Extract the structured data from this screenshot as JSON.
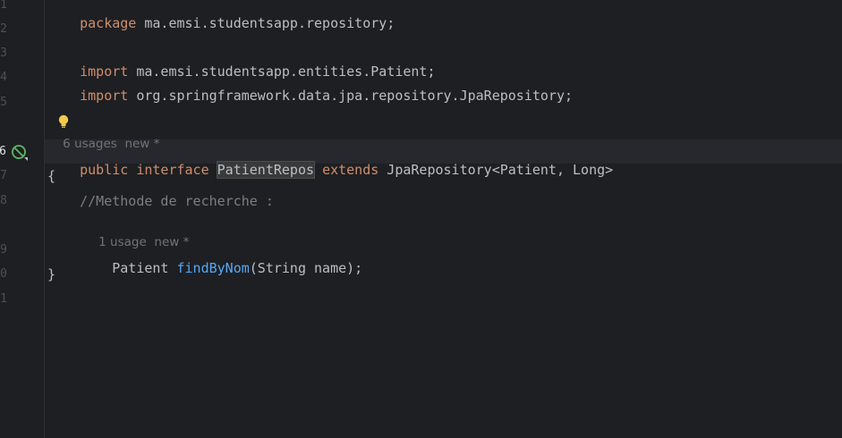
{
  "gutter": {
    "line_numbers": [
      "1",
      "2",
      "3",
      "4",
      "5",
      "6",
      "7",
      "8",
      "9",
      "0",
      "1"
    ],
    "current_line": "6",
    "icons": {
      "implement_marker": "interface-implemented-icon"
    }
  },
  "code": {
    "line1": {
      "kw": "package",
      "rest": " ma.emsi.studentsapp.repository;"
    },
    "line3": {
      "kw": "import",
      "rest": " ma.emsi.studentsapp.entities.Patient;"
    },
    "line4": {
      "kw": "import",
      "rest": " org.springframework.data.jpa.repository.JpaRepository;"
    },
    "usages_hint_1": {
      "count": "6",
      "label": "usages",
      "new": "new *"
    },
    "line6": {
      "kw1": "public",
      "kw2": "interface",
      "name": "PatientRepos",
      "kw3": "extends",
      "rest": " JpaRepository<Patient, Long>"
    },
    "line7": "{",
    "line8": "    //Methode de recherche :",
    "usages_hint_2": {
      "label": "1 usage",
      "new": "new *"
    },
    "line9": {
      "indent": "    ",
      "type": "Patient ",
      "fn": "findByNom",
      "rest": "(String name);"
    },
    "line10": "}"
  },
  "colors": {
    "background": "#1e1f22",
    "keyword": "#cf8e6d",
    "method": "#56a8f5",
    "comment": "#7a7e85",
    "text": "#bcbec4",
    "current_line": "#26282e"
  },
  "bulb_icon": "lightbulb-icon"
}
